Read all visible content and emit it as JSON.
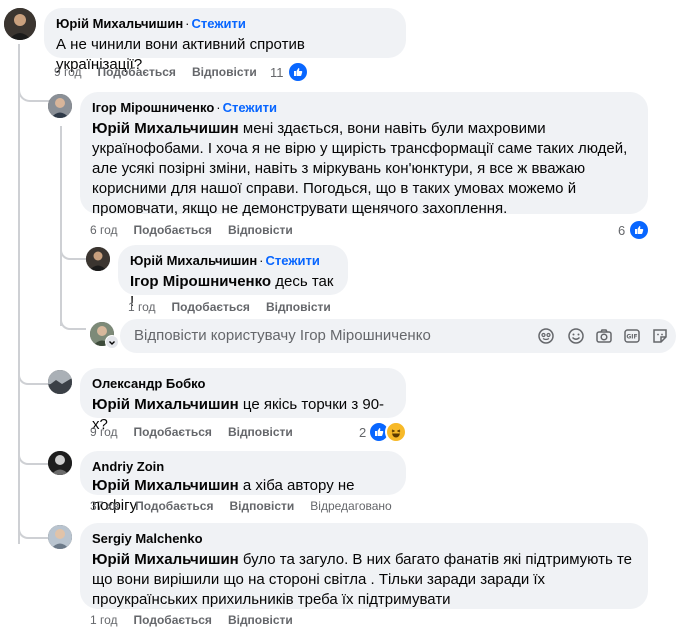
{
  "comments": [
    {
      "author": "Юрій Михальчишин",
      "follow": "Стежити",
      "text": "А не чинили вони активний спротив українізації?",
      "time": "9 год",
      "like": "Подобається",
      "reply": "Відповісти",
      "reactions": "11"
    },
    {
      "author": "Ігор Мірошниченко",
      "follow": "Стежити",
      "mention": "Юрій Михальчишин",
      "text_lines": [
        " мені здається, вони навіть були махровими",
        "українофобами. І хоча я не вірю у щирість трансформації саме таких людей,",
        "але усякі позірні зміни, навіть з міркувань кон'юнктури, я все ж вважаю",
        "корисними для нашої справи. Погодься, що в таких умовах можемо й",
        "промовчати, якщо не демонструвати щенячого захоплення."
      ],
      "time": "6 год",
      "like": "Подобається",
      "reply": "Відповісти",
      "reactions": "6"
    },
    {
      "author": "Юрій Михальчишин",
      "follow": "Стежити",
      "mention": "Ігор Мірошниченко",
      "text": " десь так !",
      "time": "1 год",
      "like": "Подобається",
      "reply": "Відповісти"
    },
    {
      "author": "Олександр Бобко",
      "mention": "Юрій Михальчишин",
      "text": " це якісь торчки з 90-х?",
      "time": "9 год",
      "like": "Подобається",
      "reply": "Відповісти",
      "reactions": "2"
    },
    {
      "author": "Andriy Zoin",
      "mention": "Юрій Михальчишин",
      "text": " а хіба автору не пофігу",
      "time": "37 хв",
      "like": "Подобається",
      "reply": "Відповісти",
      "edited": "Відредаговано"
    },
    {
      "author": "Sergiy Malchenko",
      "mention": "Юрій Михальчишин",
      "text_lines": [
        " було та загуло. В них багато фанатів які підтримують те",
        "що вони вирішили що на стороні світла . Тільки заради заради їх",
        "проукраїнських прихильників треба їх підтримувати"
      ],
      "time": "1 год",
      "like": "Подобається",
      "reply": "Відповісти"
    }
  ],
  "reply_box": {
    "placeholder": "Відповісти користувачу Ігор Мірошниченко"
  },
  "colors": {
    "link": "#0866ff",
    "bubble": "#f0f2f5",
    "meta": "#65676b"
  }
}
